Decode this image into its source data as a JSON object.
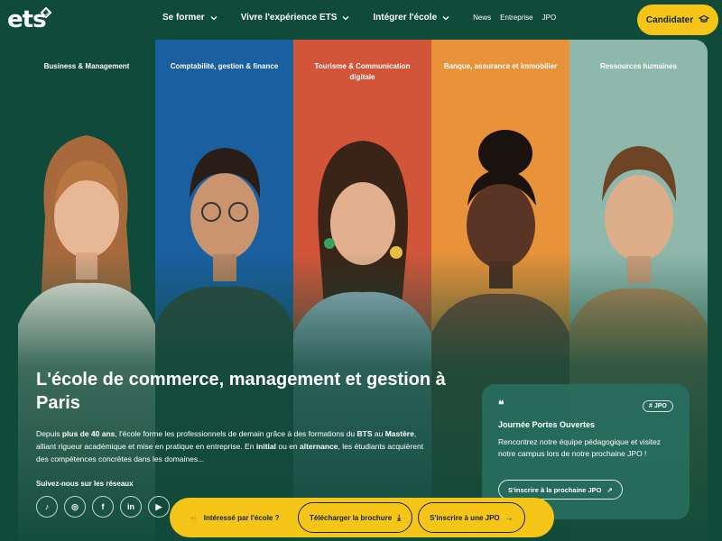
{
  "brand": {
    "logo_text": "ets"
  },
  "nav": {
    "items": [
      {
        "label": "Se former",
        "has_dropdown": true
      },
      {
        "label": "Vivre l'expérience ETS",
        "has_dropdown": true
      },
      {
        "label": "Intégrer l'école",
        "has_dropdown": true
      }
    ],
    "small_links": [
      "News",
      "Entreprise",
      "JPO"
    ],
    "cta_label": "Candidater",
    "cta_icon": "graduation-cap-icon"
  },
  "panels": [
    {
      "label": "Business & Management",
      "color": "#0f4a3a"
    },
    {
      "label": "Comptabilité, gestion & finance",
      "color": "#1a5fa0"
    },
    {
      "label": "Tourisme & Communication digitale",
      "color": "#d2553a"
    },
    {
      "label": "Banque, assurance et immobilier",
      "color": "#e8923a"
    },
    {
      "label": "Ressources humaines",
      "color": "#8fb8ac"
    }
  ],
  "hero": {
    "headline": "L'école de commerce, management et gestion à Paris",
    "desc_1": "Depuis ",
    "desc_b1": "plus de 40 ans",
    "desc_2": ", l'école forme les professionnels de demain grâce à des formations du ",
    "desc_b2": "BTS",
    "desc_3": " au ",
    "desc_b3": "Mastère",
    "desc_4": ", alliant rigueur académique et mise en pratique en entreprise. En ",
    "desc_b4": "initial",
    "desc_5": " ou en ",
    "desc_b5": "alternance",
    "desc_6": ", les étudiants acquièrent des compétences concrètes dans les domaines...",
    "social_title": "Suivez-nous sur les réseaux",
    "social": [
      {
        "name": "tiktok-icon",
        "glyph": "♪"
      },
      {
        "name": "instagram-icon",
        "glyph": "◎"
      },
      {
        "name": "facebook-icon",
        "glyph": "f"
      },
      {
        "name": "linkedin-icon",
        "glyph": "in"
      },
      {
        "name": "youtube-icon",
        "glyph": "▶"
      }
    ]
  },
  "jpo_card": {
    "quote_mark": "❝",
    "tag": "# JPO",
    "title": "Journée Portes Ouvertes",
    "text": "Rencontrez notre équipe pédagogique et visitez notre campus lors de notre prochaine JPO !",
    "link_label": "S'inscrire à la prochaine JPO",
    "link_arrow": "↗"
  },
  "action_bar": {
    "item1_label": "Intéressé par l'école ?",
    "item1_icon": "☝",
    "item2_label": "Télécharger la brochure",
    "item2_icon": "⤓",
    "item3_label": "S'inscrire à une JPO",
    "item3_icon": "→"
  }
}
